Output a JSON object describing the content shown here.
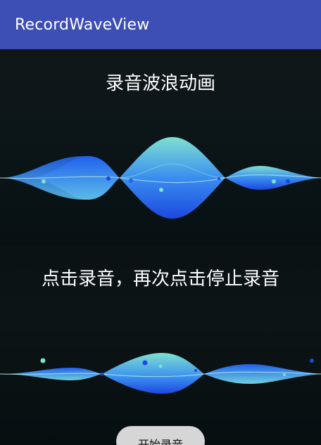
{
  "app_bar": {
    "title": "RecordWaveView",
    "color": "#3d4fb5"
  },
  "section1": {
    "heading": "录音波浪动画"
  },
  "section2": {
    "heading": "点击录音，再次点击停止录音"
  },
  "controls": {
    "start_label": "开始录音"
  },
  "colors": {
    "wave_blue": "#1f53e6",
    "wave_teal": "#7fe0d0",
    "background": "#0b1416"
  }
}
